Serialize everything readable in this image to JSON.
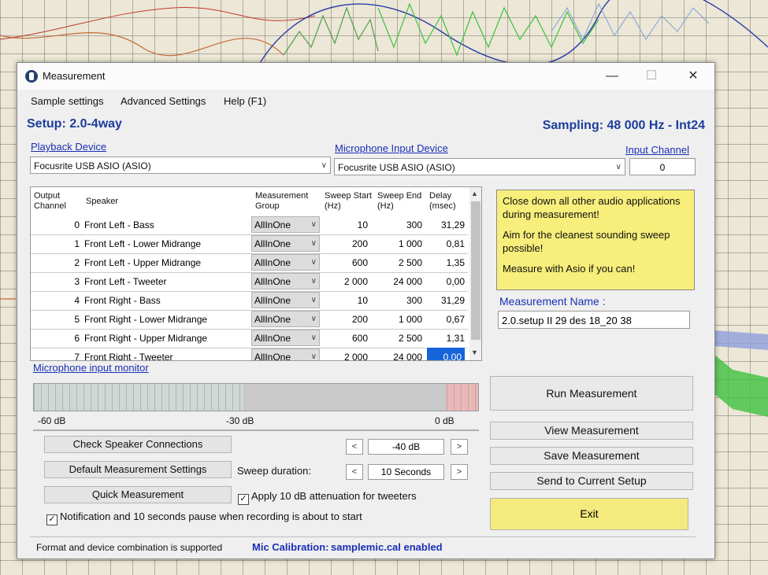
{
  "window": {
    "title": "Measurement",
    "minimize": "—",
    "maximize": "☐",
    "close": "✕"
  },
  "menu": [
    "Sample settings",
    "Advanced Settings",
    "Help (F1)"
  ],
  "setup": "Setup: 2.0-4way",
  "sampling": "Sampling: 48 000 Hz - Int24",
  "playback": {
    "label": "Playback Device",
    "value": "Focusrite USB ASIO (ASIO)"
  },
  "microphone": {
    "label": "Microphone Input Device",
    "value": "Focusrite USB ASIO (ASIO)"
  },
  "input_channel": {
    "label": "Input Channel",
    "value": "0"
  },
  "table": {
    "headers": {
      "output": "Output Channel",
      "speaker": "Speaker",
      "group": "Measurement Group",
      "start": "Sweep Start (Hz)",
      "end": "Sweep End (Hz)",
      "delay": "Delay (msec)"
    },
    "rows": [
      {
        "ch": "0",
        "speaker": "Front Left - Bass",
        "group": "AllInOne",
        "start": "10",
        "end": "300",
        "delay": "31,29"
      },
      {
        "ch": "1",
        "speaker": "Front Left - Lower Midrange",
        "group": "AllInOne",
        "start": "200",
        "end": "1 000",
        "delay": "0,81"
      },
      {
        "ch": "2",
        "speaker": "Front Left - Upper Midrange",
        "group": "AllInOne",
        "start": "600",
        "end": "2 500",
        "delay": "1,35"
      },
      {
        "ch": "3",
        "speaker": "Front Left - Tweeter",
        "group": "AllInOne",
        "start": "2 000",
        "end": "24 000",
        "delay": "0,00"
      },
      {
        "ch": "4",
        "speaker": "Front Right - Bass",
        "group": "AllInOne",
        "start": "10",
        "end": "300",
        "delay": "31,29"
      },
      {
        "ch": "5",
        "speaker": "Front Right - Lower Midrange",
        "group": "AllInOne",
        "start": "200",
        "end": "1 000",
        "delay": "0,67"
      },
      {
        "ch": "6",
        "speaker": "Front Right - Upper Midrange",
        "group": "AllInOne",
        "start": "600",
        "end": "2 500",
        "delay": "1,31"
      },
      {
        "ch": "7",
        "speaker": "Front Right - Tweeter",
        "group": "AllInOne",
        "start": "2 000",
        "end": "24 000",
        "delay": "0,00"
      }
    ]
  },
  "note": [
    "Close down all other audio applications during measurement!",
    "Aim for the cleanest sounding sweep possible!",
    "Measure with Asio if you can!"
  ],
  "measurement_name": {
    "label": "Measurement Name :",
    "value": "2.0.setup II 29 des 18_20 38"
  },
  "monitor": {
    "label": "Microphone input monitor",
    "min": "-60 dB",
    "mid": "-30 dB",
    "max": "0 dB"
  },
  "buttons": {
    "check": "Check Speaker Connections",
    "defaults": "Default Measurement Settings",
    "quick": "Quick Measurement",
    "run": "Run Measurement",
    "view": "View Measurement",
    "save": "Save Measurement",
    "send": "Send to Current Setup",
    "exit": "Exit"
  },
  "level": {
    "value": "-40 dB",
    "dec": "<",
    "inc": ">"
  },
  "sweep": {
    "label": "Sweep duration:",
    "value": "10 Seconds",
    "dec": "<",
    "inc": ">"
  },
  "attenuation": {
    "label": "Apply 10 dB attenuation for tweeters",
    "checked": true
  },
  "notification": {
    "label": "Notification and 10 seconds pause when recording is about to start",
    "checked": true
  },
  "status": {
    "text": "Format and device combination is supported",
    "mic_label": "Mic Calibration:",
    "mic_value": "samplemic.cal enabled"
  },
  "colors": {
    "accent": "#1c3d9c",
    "link": "#1a2fb5",
    "note": "#f7ee7b",
    "selected": "#1565d8"
  }
}
